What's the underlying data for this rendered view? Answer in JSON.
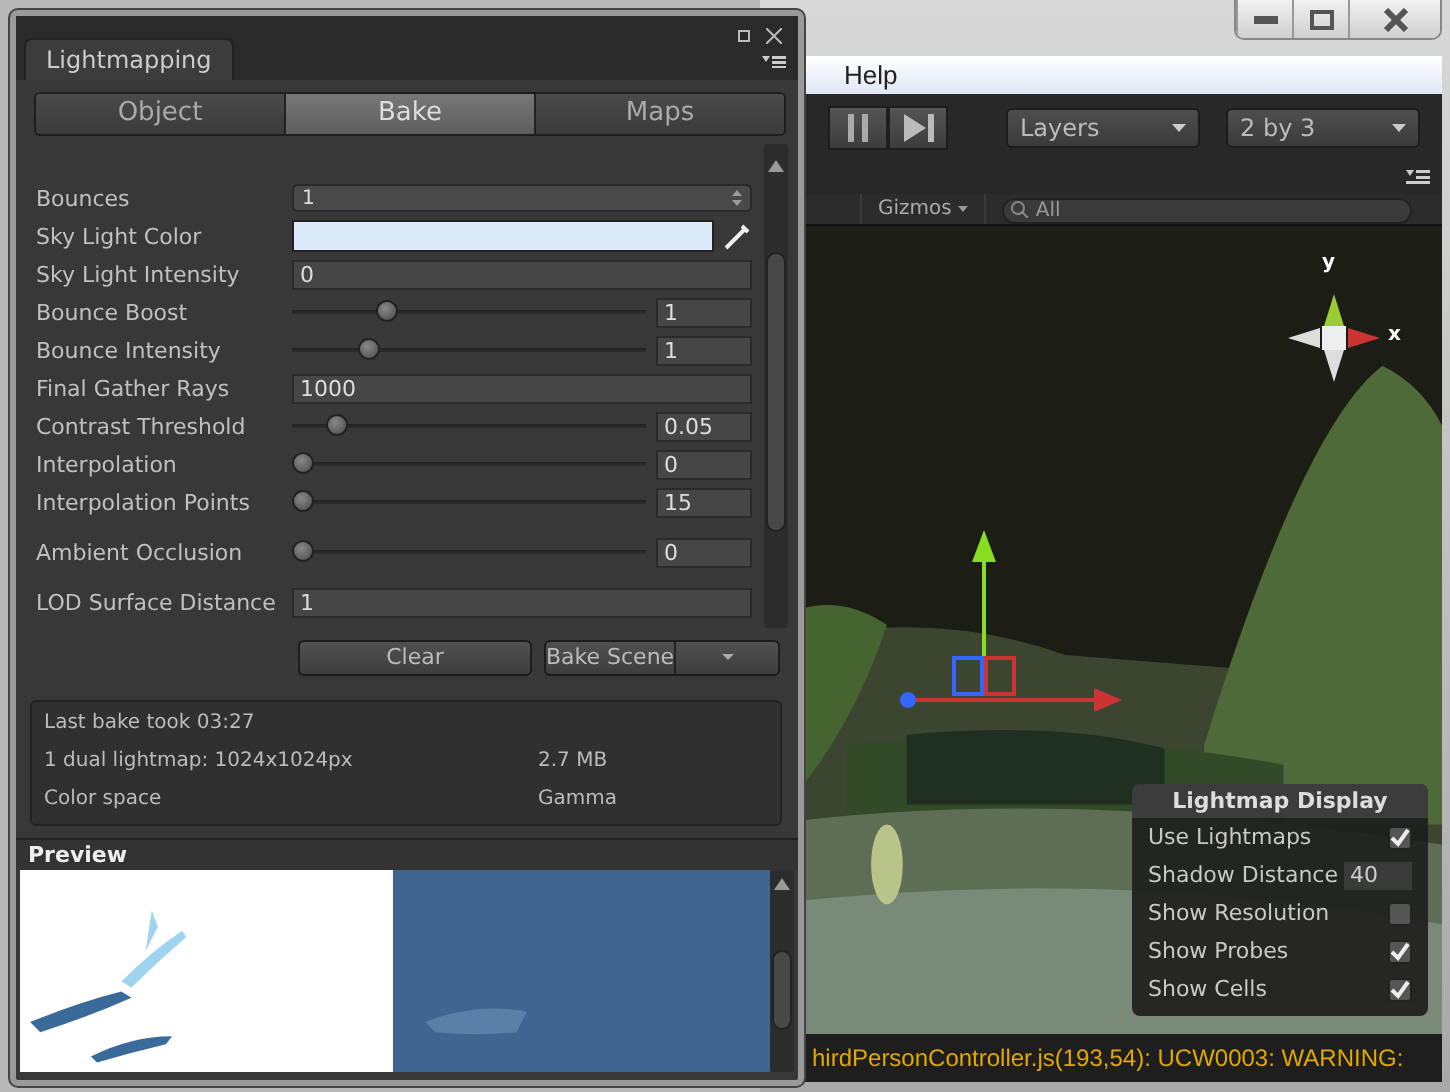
{
  "background_window": {
    "menu": [
      "Help"
    ],
    "toolbar": {
      "layers": "Layers",
      "layout": "2 by 3"
    },
    "scene_toolbar": {
      "gizmos": "Gizmos",
      "search_placeholder": "All"
    },
    "axis_labels": [
      "y",
      "x"
    ],
    "lightmap_display": {
      "title": "Lightmap Display",
      "items": [
        {
          "label": "Use Lightmaps",
          "kind": "checkbox",
          "checked": true
        },
        {
          "label": "Shadow Distance",
          "kind": "field",
          "value": "40"
        },
        {
          "label": "Show Resolution",
          "kind": "checkbox",
          "checked": false
        },
        {
          "label": "Show Probes",
          "kind": "checkbox",
          "checked": true
        },
        {
          "label": "Show Cells",
          "kind": "checkbox",
          "checked": true
        }
      ]
    },
    "status_bar": "hirdPersonController.js(193,54): UCW0003: WARNING:"
  },
  "lightmapping": {
    "tab": "Lightmapping",
    "mode_tabs": [
      {
        "label": "Object",
        "selected": false
      },
      {
        "label": "Bake",
        "selected": true
      },
      {
        "label": "Maps",
        "selected": false
      }
    ],
    "settings": [
      {
        "label": "Bounces",
        "kind": "dropdown",
        "value": "1"
      },
      {
        "label": "Sky Light Color",
        "kind": "color",
        "color": "#dcebfa"
      },
      {
        "label": "Sky Light Intensity",
        "kind": "field",
        "value": "0"
      },
      {
        "label": "Bounce Boost",
        "kind": "slider",
        "level": 0.25,
        "value": "1"
      },
      {
        "label": "Bounce Intensity",
        "kind": "slider",
        "level": 0.2,
        "value": "1"
      },
      {
        "label": "Final Gather Rays",
        "kind": "field",
        "value": "1000"
      },
      {
        "label": "Contrast Threshold",
        "kind": "slider",
        "level": 0.1,
        "value": "0.05"
      },
      {
        "label": "Interpolation",
        "kind": "slider",
        "level": 0,
        "value": "0"
      },
      {
        "label": "Interpolation Points",
        "kind": "slider",
        "level": 0,
        "value": "15"
      },
      {
        "label": "Ambient Occlusion",
        "kind": "slider",
        "level": 0,
        "value": "0",
        "gap": true
      },
      {
        "label": "LOD Surface Distance",
        "kind": "field",
        "value": "1",
        "gap": true
      }
    ],
    "buttons": {
      "clear": "Clear",
      "bake": "Bake Scene"
    },
    "info": [
      {
        "label": "Last bake took 03:27"
      },
      {
        "label": "1 dual lightmap: 1024x1024px",
        "value": "2.7 MB"
      },
      {
        "label": "Color space",
        "value": "Gamma"
      }
    ],
    "preview_title": "Preview"
  }
}
